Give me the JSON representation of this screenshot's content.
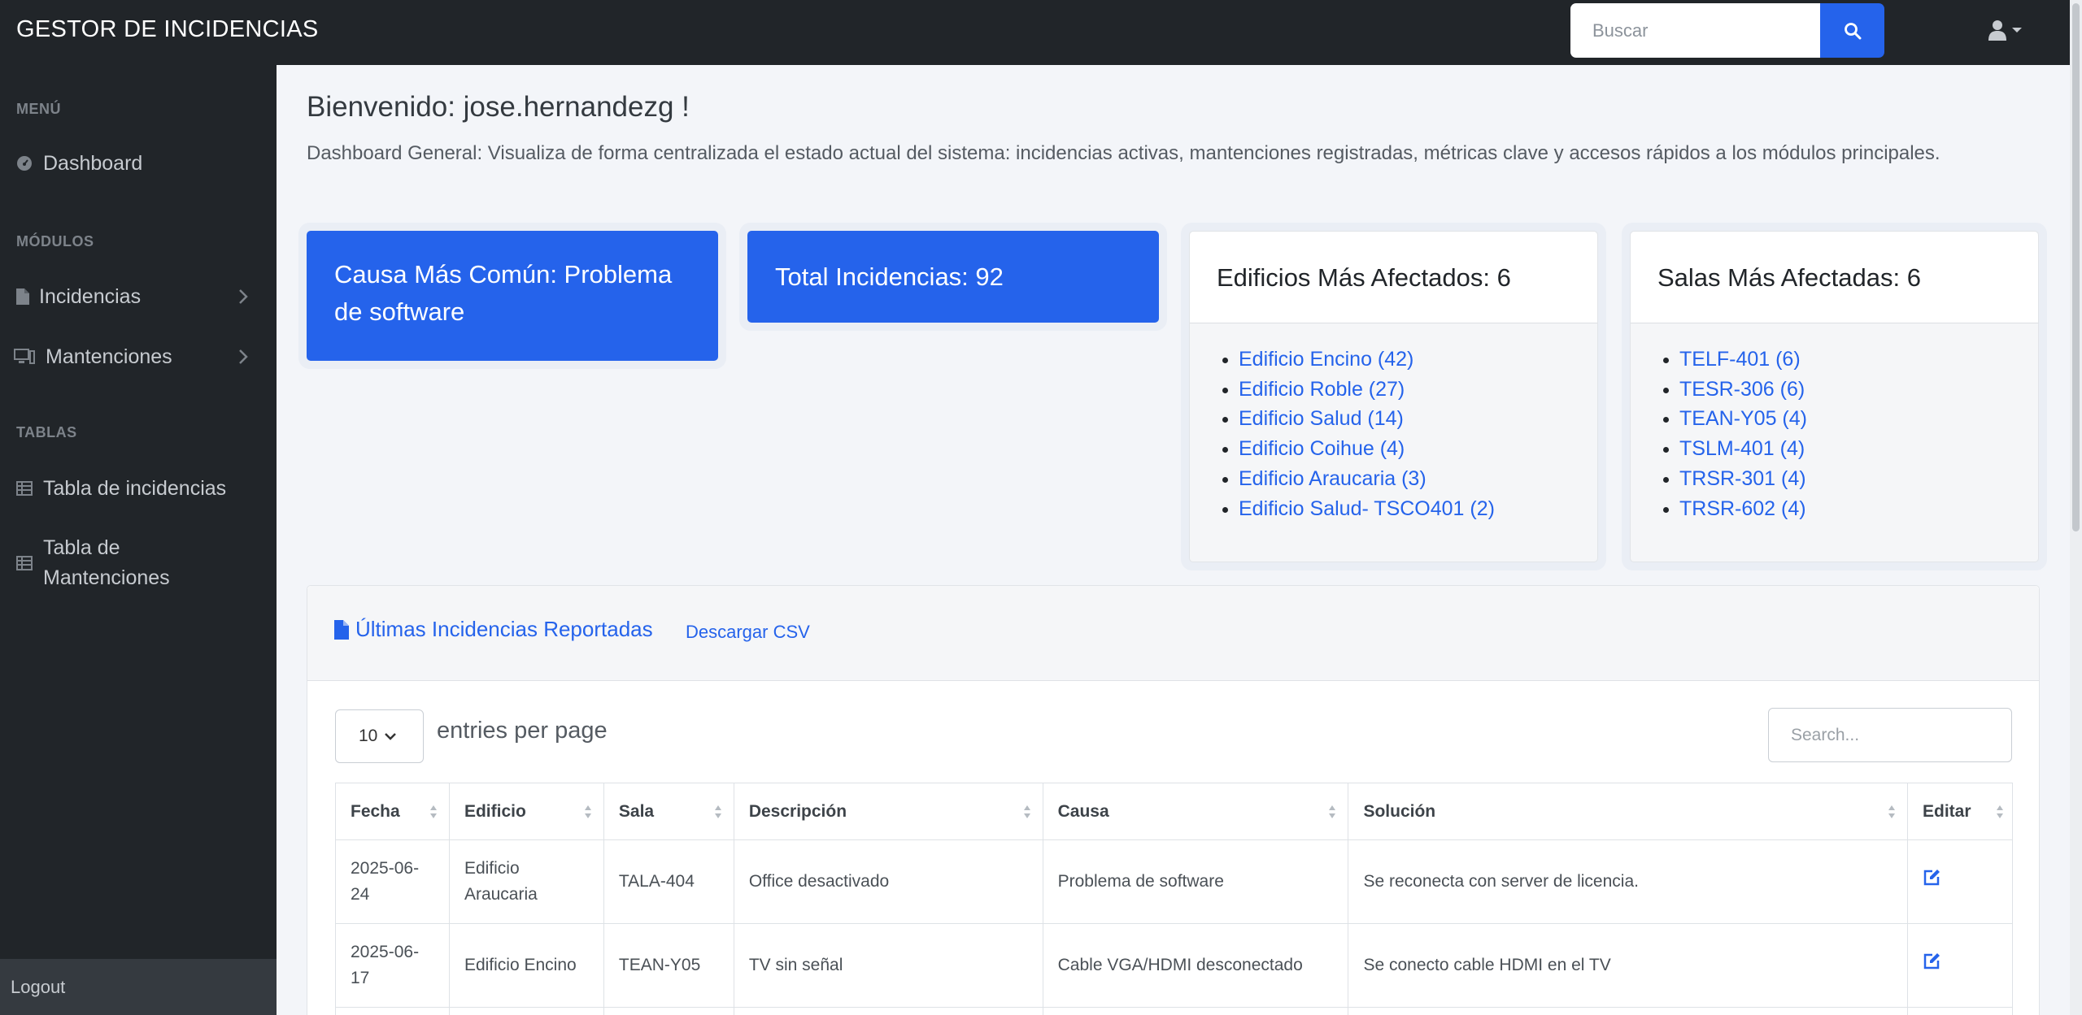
{
  "navbar": {
    "brand": "GESTOR DE INCIDENCIAS",
    "search_placeholder": "Buscar"
  },
  "sidebar": {
    "heading_menu": "MENÚ",
    "heading_modules": "MÓDULOS",
    "heading_tables": "TABLAS",
    "items": [
      {
        "label": "Dashboard",
        "icon": "dashboard-icon"
      },
      {
        "label": "Incidencias",
        "icon": "file-icon"
      },
      {
        "label": "Mantenciones",
        "icon": "desktop-icon"
      },
      {
        "label": "Tabla de incidencias",
        "icon": "table-icon"
      },
      {
        "label": "Tabla de Mantenciones",
        "icon": "table-icon"
      }
    ],
    "logout": "Logout"
  },
  "main": {
    "welcome": "Bienvenido: jose.hernandezg !",
    "intro": "Dashboard General: Visualiza de forma centralizada el estado actual del sistema: incidencias activas, mantenciones registradas, métricas clave y accesos rápidos a los módulos principales."
  },
  "stats": {
    "common_cause": "Causa Más Común: Problema de software",
    "total": "Total Incidencias: 92",
    "buildings_title": "Edificios Más Afectados: 6",
    "buildings": [
      "Edificio Encino (42)",
      "Edificio Roble (27)",
      "Edificio Salud (14)",
      "Edificio Coihue (4)",
      "Edificio Araucaria (3)",
      "Edificio Salud- TSCO401 (2)"
    ],
    "rooms_title": "Salas Más Afectadas: 6",
    "rooms": [
      "TELF-401 (6)",
      "TESR-306 (6)",
      "TEAN-Y05 (4)",
      "TSLM-401 (4)",
      "TRSR-301 (4)",
      "TRSR-602 (4)"
    ]
  },
  "table_card": {
    "title": "Últimas Incidencias Reportadas",
    "csv_link": "Descargar CSV",
    "per_page_value": "10",
    "per_page_label": "entries per page",
    "search_placeholder": "Search...",
    "columns": [
      "Fecha",
      "Edificio",
      "Sala",
      "Descripción",
      "Causa",
      "Solución",
      "Editar"
    ],
    "rows": [
      {
        "fecha": "2025-06-24",
        "edificio": "Edificio Araucaria",
        "sala": "TALA-404",
        "descripcion": "Office desactivado",
        "causa": "Problema de software",
        "solucion": "Se reconecta con server de licencia."
      },
      {
        "fecha": "2025-06-17",
        "edificio": "Edificio Encino",
        "sala": "TEAN-Y05",
        "descripcion": "TV sin señal",
        "causa": "Cable VGA/HDMI desconectado",
        "solucion": "Se conecto cable HDMI en el TV"
      }
    ]
  },
  "colors": {
    "accent": "#2563eb",
    "sidebar_bg": "#212529",
    "page_bg": "#f3f5f9"
  }
}
